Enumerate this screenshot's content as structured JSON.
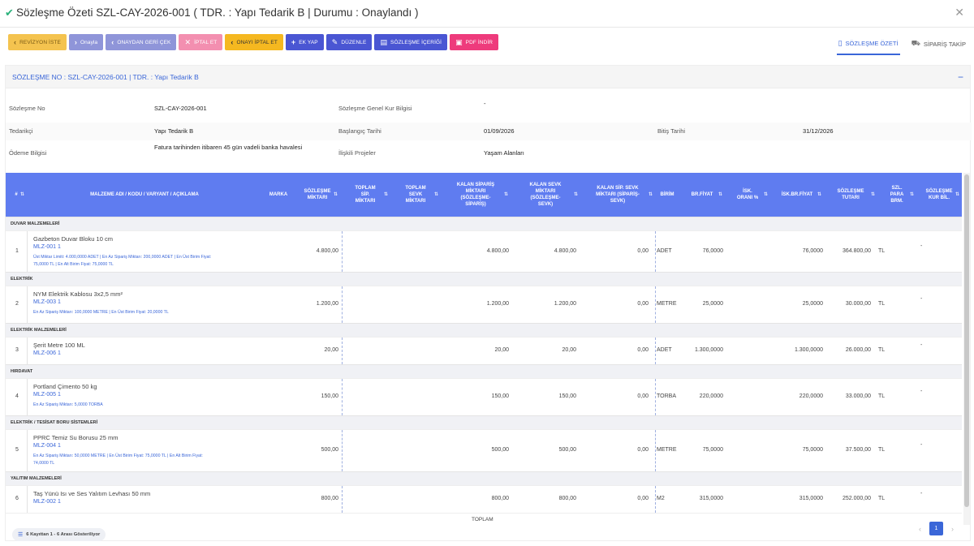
{
  "header": {
    "title": "Sözleşme Özeti SZL-CAY-2026-001 ( TDR. : Yapı Tedarik B | Durumu : Onaylandı )"
  },
  "toolbar": {
    "buttons": [
      {
        "label": "REVİZYON İSTE",
        "icon": "chevron-left-icon",
        "color": "#f4c34f"
      },
      {
        "label": "Onayla",
        "icon": "chevron-right-icon",
        "color": "#8f95d9"
      },
      {
        "label": "ONAYDAN GERİ ÇEK",
        "icon": "chevron-left-icon",
        "color": "#8f95d9"
      },
      {
        "label": "İPTAL ET",
        "icon": "x-icon",
        "color": "#f38fb0"
      },
      {
        "label": "ONAYI İPTAL ET",
        "icon": "chevron-left-icon",
        "color": "#f5b820"
      },
      {
        "label": "EK YAP",
        "icon": "plus-icon",
        "color": "#4a56d3"
      },
      {
        "label": "DÜZENLE",
        "icon": "edit-icon",
        "color": "#4a56d3"
      },
      {
        "label": "SÖZLEŞME İÇERİĞİ",
        "icon": "document-icon",
        "color": "#4a56d3"
      },
      {
        "label": "PDF İNDİR",
        "icon": "pdf-icon",
        "color": "#ee3b7c"
      }
    ]
  },
  "tabs": [
    {
      "label": "SÖZLEŞME ÖZETİ",
      "icon": "document-icon",
      "active": true
    },
    {
      "label": "SİPARİŞ TAKİP",
      "icon": "cart-icon",
      "active": false
    }
  ],
  "panel": {
    "title": "SÖZLEŞME NO : SZL-CAY-2026-001 | TDR. : Yapı Tedarik B",
    "fields": {
      "sozlesme_no_label": "Sözleşme No",
      "sozlesme_no": "SZL-CAY-2026-001",
      "kur_label": "Sözleşme Genel Kur Bilgisi",
      "kur": "-",
      "tedarikci_label": "Tedarikçi",
      "tedarikci": "Yapı Tedarik B",
      "baslangic_label": "Başlangıç Tarihi",
      "baslangic": "01/09/2026",
      "bitis_label": "Bitiş Tarihi",
      "bitis": "31/12/2026",
      "odeme_label": "Ödeme Bilgisi",
      "odeme": "Fatura tarihinden itibaren 45 gün vadeli banka havalesi",
      "projeler_label": "İlişkili Projeler",
      "projeler": "Yaşam Alanları"
    }
  },
  "table": {
    "columns": [
      "#",
      "MALZEME ADI / KODU / VARYANT / AÇIKLAMA",
      "MARKA",
      "SÖZLEŞME MİKTARI",
      "TOPLAM SİP. MİKTARI",
      "TOPLAM SEVK MİKTARI",
      "KALAN SİPARİŞ MİKTARI (SÖZLEŞME-SİPARİŞ)",
      "KALAN SEVK MİKTARI (SÖZLEŞME-SEVK)",
      "KALAN SİP. SEVK MİKTARI (SİPARİŞ-SEVK)",
      "BİRİM",
      "BR.FİYAT",
      "İSK. ORANI %",
      "İSK.BR.FİYAT",
      "SÖZLEŞME TUTARI",
      "SZL. PARA BRM.",
      "SÖZLEŞME KUR BİL."
    ],
    "groups": [
      {
        "name": "DUVAR MALZEMELERİ",
        "rows": [
          {
            "no": "1",
            "name": "Gazbeton Duvar Bloku 10 cm",
            "code": "MLZ-001 1",
            "notes": [
              "Üst Miktar Limiti: 4.000,0000 ADET  |  En Az Sipariş Miktarı: 200,0000 ADET  |  En Üst Birim Fiyat:",
              "75,0000 TL  |  En Alt Birim Fiyat: 75,0000 TL"
            ],
            "sozlesme": "4.800,00",
            "kalan_sip": "4.800,00",
            "kalan_sevk": "4.800,00",
            "kalan_sip_sevk": "0,00",
            "birim": "ADET",
            "br_fiyat": "76,0000",
            "isk_br_fiyat": "76,0000",
            "tutar": "364.800,00",
            "para": "TL",
            "kur": "-"
          }
        ]
      },
      {
        "name": "ELEKTRİK",
        "rows": [
          {
            "no": "2",
            "name": "NYM Elektrik Kablosu 3x2,5 mm²",
            "code": "MLZ-003 1",
            "notes": [
              "En Az Sipariş Miktarı: 100,0000 METRE  |  En Üst Birim Fiyat: 20,0000 TL"
            ],
            "sozlesme": "1.200,00",
            "kalan_sip": "1.200,00",
            "kalan_sevk": "1.200,00",
            "kalan_sip_sevk": "0,00",
            "birim": "METRE",
            "br_fiyat": "25,0000",
            "isk_br_fiyat": "25,0000",
            "tutar": "30.000,00",
            "para": "TL",
            "kur": "-"
          }
        ]
      },
      {
        "name": "ELEKTRİK MALZEMELERİ",
        "rows": [
          {
            "no": "3",
            "name": "Şerit Metre 100 ML",
            "code": "MLZ-006 1",
            "notes": [],
            "sozlesme": "20,00",
            "kalan_sip": "20,00",
            "kalan_sevk": "20,00",
            "kalan_sip_sevk": "0,00",
            "birim": "ADET",
            "br_fiyat": "1.300,0000",
            "isk_br_fiyat": "1.300,0000",
            "tutar": "26.000,00",
            "para": "TL",
            "kur": "-"
          }
        ]
      },
      {
        "name": "HIRDAVAT",
        "rows": [
          {
            "no": "4",
            "name": "Portland Çimento 50 kg",
            "code": "MLZ-005 1",
            "notes": [
              "En Az Sipariş Miktarı: 5,0000 TORBA"
            ],
            "sozlesme": "150,00",
            "kalan_sip": "150,00",
            "kalan_sevk": "150,00",
            "kalan_sip_sevk": "0,00",
            "birim": "TORBA",
            "br_fiyat": "220,0000",
            "isk_br_fiyat": "220,0000",
            "tutar": "33.000,00",
            "para": "TL",
            "kur": "-"
          }
        ]
      },
      {
        "name": "ELEKTRİK / TESİSAT BORU SİSTEMLERİ",
        "rows": [
          {
            "no": "5",
            "name": "PPRC Temiz Su Borusu 25 mm",
            "code": "MLZ-004 1",
            "notes": [
              "En Az Sipariş Miktarı: 50,0000 METRE  |  En Üst Birim Fiyat: 75,0000 TL  |  En Alt Birim Fiyat:",
              "74,0000 TL"
            ],
            "sozlesme": "500,00",
            "kalan_sip": "500,00",
            "kalan_sevk": "500,00",
            "kalan_sip_sevk": "0,00",
            "birim": "METRE",
            "br_fiyat": "75,0000",
            "isk_br_fiyat": "75,0000",
            "tutar": "37.500,00",
            "para": "TL",
            "kur": "-"
          }
        ]
      },
      {
        "name": "YALITIM MALZEMELERİ",
        "rows": [
          {
            "no": "6",
            "name": "Taş Yünü Isı ve Ses Yalıtım Levhası 50 mm",
            "code": "MLZ-002 1",
            "notes": [],
            "sozlesme": "800,00",
            "kalan_sip": "800,00",
            "kalan_sevk": "800,00",
            "kalan_sip_sevk": "0,00",
            "birim": "M2",
            "br_fiyat": "315,0000",
            "isk_br_fiyat": "315,0000",
            "tutar": "252.000,00",
            "para": "TL",
            "kur": "-"
          }
        ]
      }
    ],
    "total_label": "TOPLAM"
  },
  "footer": {
    "info": "6 Kayıttan 1 - 6 Arası Gösteriliyor",
    "page": "1"
  },
  "colors": {
    "accent": "#3a66d8",
    "table_header": "#5f7cf0",
    "success": "#2ab27b"
  }
}
